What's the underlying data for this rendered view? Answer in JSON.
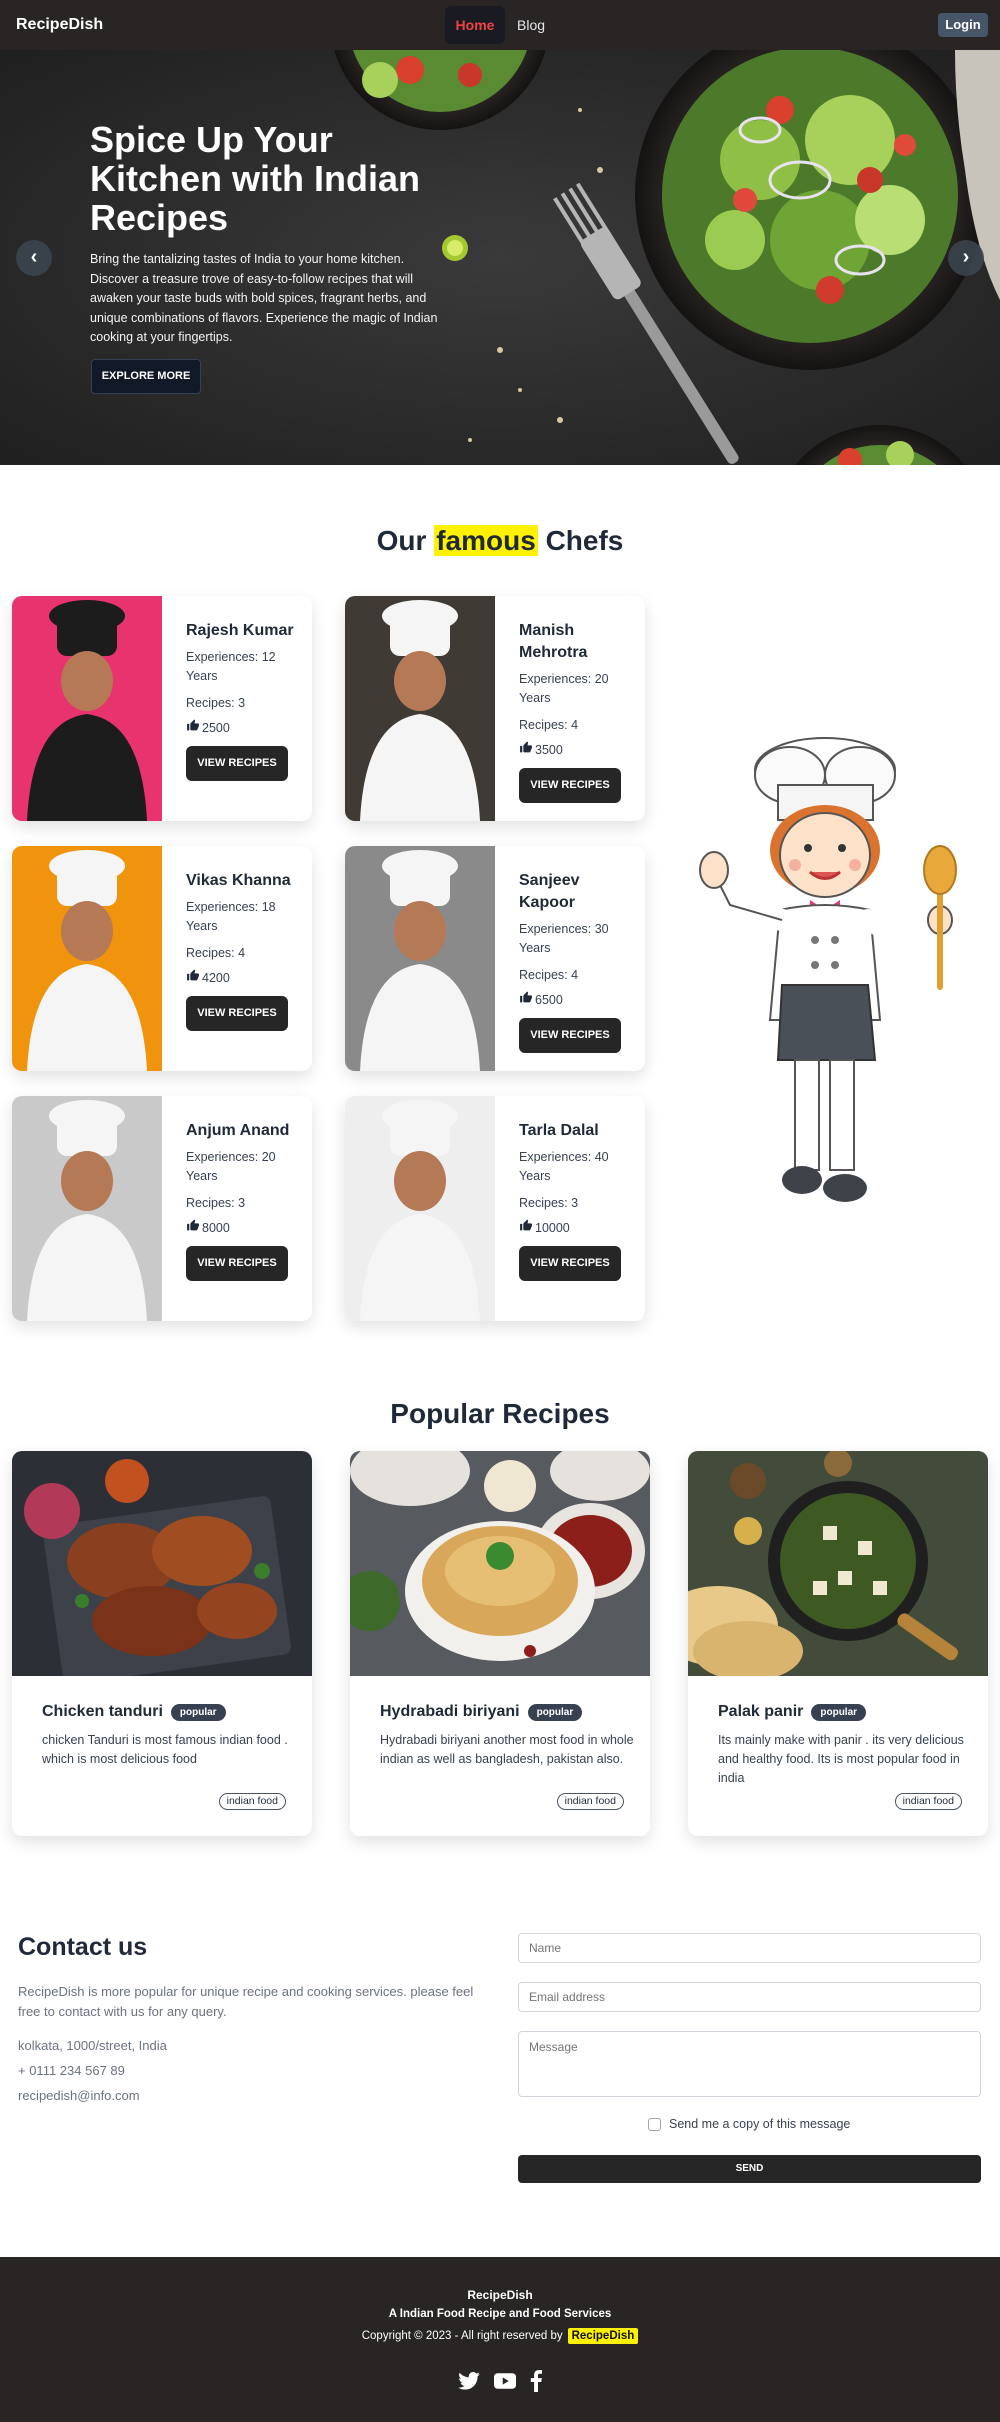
{
  "navbar": {
    "brand": "RecipeDish",
    "links": [
      {
        "label": "Home",
        "active": true
      },
      {
        "label": "Blog",
        "active": false
      }
    ],
    "login_label": "Login"
  },
  "hero": {
    "title": "Spice Up Your Kitchen with Indian Recipes",
    "description": "Bring the tantalizing tastes of India to your home kitchen. Discover a treasure trove of easy-to-follow recipes that will awaken your taste buds with bold spices, fragrant herbs, and unique combinations of flavors. Experience the magic of Indian cooking at your fingertips.",
    "cta_label": "EXPLORE MORE",
    "prev_icon": "chevron-left-icon",
    "next_icon": "chevron-right-icon",
    "prev_glyph": "‹",
    "next_glyph": "›"
  },
  "chefs": {
    "title_before": "Our",
    "title_highlight": "famous",
    "title_after": "Chefs",
    "highlight_color": "#fef200",
    "button_label": "VIEW RECIPES",
    "items": [
      {
        "name": "Rajesh Kumar",
        "experience": "Experiences: 12 Years",
        "recipes": "Recipes: 3",
        "likes": "2500",
        "bg": "#e8336e"
      },
      {
        "name": "Manish Mehrotra",
        "experience": "Experiences: 20 Years",
        "recipes": "Recipes: 4",
        "likes": "3500",
        "bg": "#3f3a33"
      },
      {
        "name": "Vikas Khanna",
        "experience": "Experiences: 18 Years",
        "recipes": "Recipes: 4",
        "likes": "4200",
        "bg": "#f0940e"
      },
      {
        "name": "Sanjeev Kapoor",
        "experience": "Experiences: 30 Years",
        "recipes": "Recipes: 4",
        "likes": "6500",
        "bg": "#8a8a8a"
      },
      {
        "name": "Anjum Anand",
        "experience": "Experiences: 20 Years",
        "recipes": "Recipes: 3",
        "likes": "8000",
        "bg": "#c9c9c9"
      },
      {
        "name": "Tarla Dalal",
        "experience": "Experiences: 40 Years",
        "recipes": "Recipes: 3",
        "likes": "10000",
        "bg": "#eeeeee"
      }
    ]
  },
  "recipes": {
    "title": "Popular Recipes",
    "badge": "popular",
    "items": [
      {
        "name": "Chicken tanduri",
        "description": "chicken Tanduri is most famous indian food . which is most delicious food",
        "tag": "indian food"
      },
      {
        "name": "Hydrabadi biriyani",
        "description": "Hydrabadi biriyani another most food in whole indian as well as bangladesh, pakistan also.",
        "tag": "indian food"
      },
      {
        "name": "Palak panir",
        "description": "Its mainly make with panir . its very delicious and healthy food. Its is most popular food in india",
        "tag": "indian food"
      }
    ]
  },
  "contact": {
    "title": "Contact us",
    "description": "RecipeDish is more popular for unique recipe and cooking services. please feel free to contact with us for any query.",
    "address": "kolkata, 1000/street, India",
    "phone": "+ 0111 234 567 89",
    "email": "recipedish@info.com",
    "form": {
      "name_placeholder": "Name",
      "email_placeholder": "Email address",
      "message_placeholder": "Message",
      "copy_label": "Send me a copy of this message",
      "send_label": "SEND"
    }
  },
  "footer": {
    "brand": "RecipeDish",
    "tagline": "A Indian Food Recipe and Food Services",
    "copyright": "Copyright © 2023 - All right reserved by",
    "copyright_brand": "RecipeDish",
    "social": [
      "twitter-icon",
      "youtube-icon",
      "facebook-icon"
    ]
  }
}
